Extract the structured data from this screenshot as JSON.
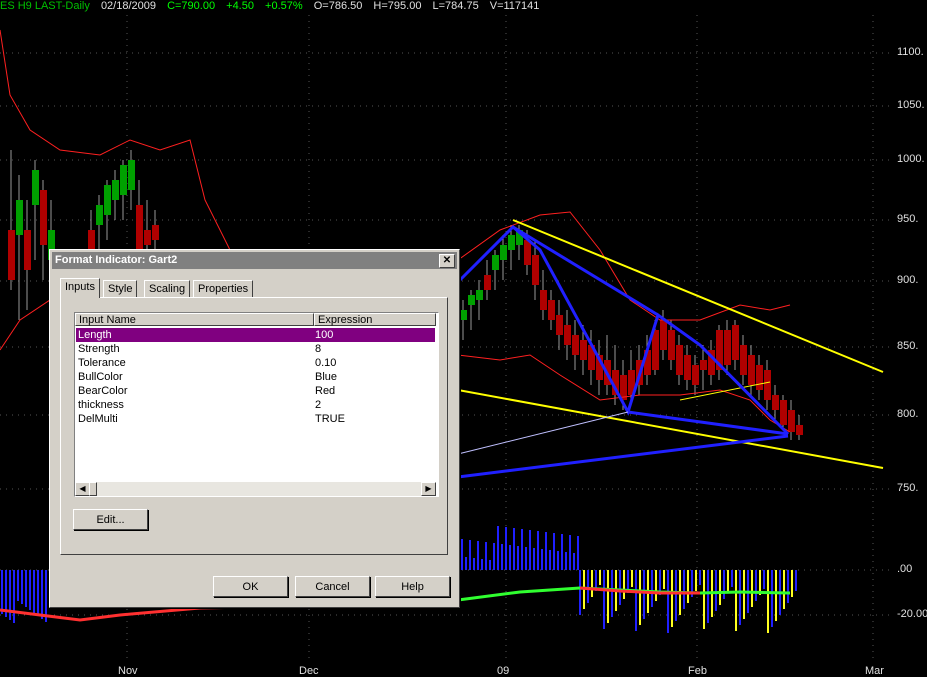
{
  "chart": {
    "header": {
      "symbol": "ES H9 LAST-Daily",
      "date": "02/18/2009",
      "close": "C=790.00",
      "change": "+4.50",
      "change_pct": "+0.57%",
      "open": "O=786.50",
      "high": "H=795.00",
      "low": "L=784.75",
      "volume": "V=117141"
    },
    "price_labels": [
      "1100.",
      "1050.",
      "1000.",
      "950.",
      "900.",
      "850.",
      "800.",
      "750.",
      ".00",
      "-20.00"
    ],
    "month_labels": [
      "Nov",
      "Dec",
      "09",
      "Feb",
      "Mar"
    ],
    "colors": {
      "up_candle": "#00a000",
      "down_candle": "#b00000",
      "pattern_lines": "#2020ff",
      "channel_lines": "#ffff00",
      "bollinger": "#ff2020",
      "histogram_pos": "#2020ff",
      "histogram_neg": "#ffff20"
    }
  },
  "dialog": {
    "title": "Format Indicator: Gart2",
    "close_label": "✕",
    "tabs": [
      "Inputs",
      "Style",
      "Scaling",
      "Properties"
    ],
    "columns": [
      "Input Name",
      "Expression"
    ],
    "rows": [
      {
        "name": "Length",
        "value": "100"
      },
      {
        "name": "Strength",
        "value": "8"
      },
      {
        "name": "Tolerance",
        "value": "0.10"
      },
      {
        "name": "BullColor",
        "value": "Blue"
      },
      {
        "name": "BearColor",
        "value": "Red"
      },
      {
        "name": "thickness",
        "value": "2"
      },
      {
        "name": "DelMulti",
        "value": "TRUE"
      }
    ],
    "edit_label": "Edit...",
    "ok_label": "OK",
    "cancel_label": "Cancel",
    "help_label": "Help"
  }
}
